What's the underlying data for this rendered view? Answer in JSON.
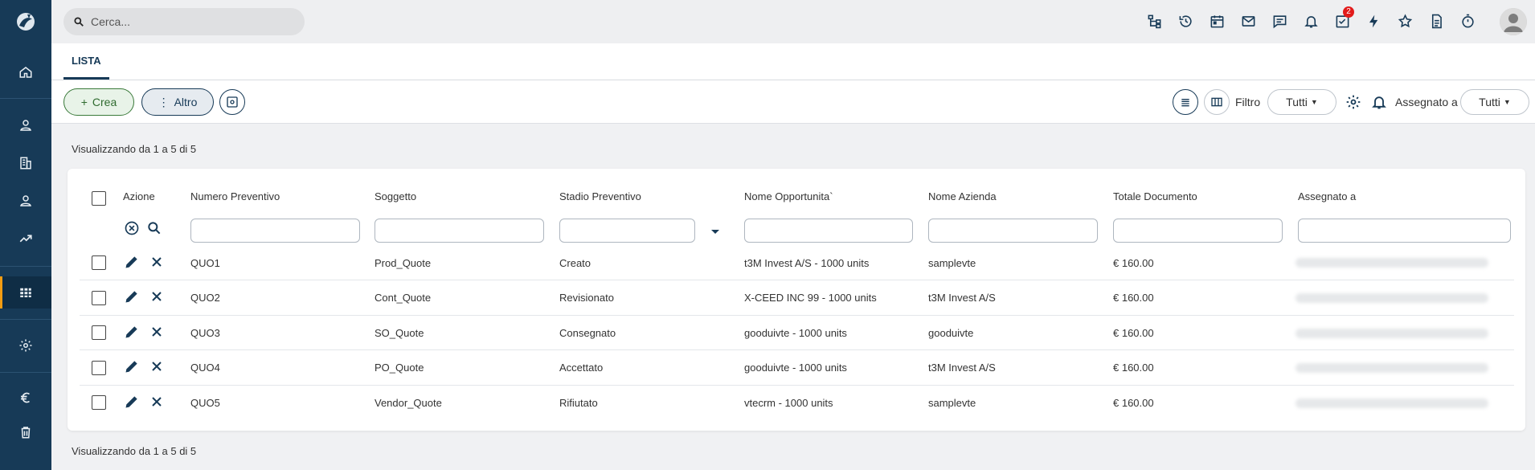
{
  "sidebar": {
    "items": [
      {
        "name": "home",
        "icon": "home-icon"
      },
      {
        "name": "contacts",
        "icon": "person-icon"
      },
      {
        "name": "companies",
        "icon": "building-icon"
      },
      {
        "name": "leads",
        "icon": "person-icon"
      },
      {
        "name": "sales",
        "icon": "trend-icon"
      },
      {
        "name": "grid",
        "icon": "grid-icon",
        "active": true
      },
      {
        "name": "settings",
        "icon": "gear-icon"
      },
      {
        "name": "finance",
        "icon": "euro-icon"
      },
      {
        "name": "trash",
        "icon": "trash-icon"
      }
    ]
  },
  "topbar": {
    "search_placeholder": "Cerca...",
    "icons": [
      "hierarchy-icon",
      "history-icon",
      "calendar-icon",
      "mail-icon",
      "chat-icon",
      "bell-icon",
      "tasks-icon",
      "bolt-icon",
      "star-icon",
      "document-icon",
      "timer-icon"
    ],
    "tasks_badge": "2"
  },
  "tabs": [
    {
      "label": "LISTA"
    }
  ],
  "toolbar": {
    "create_label": "Crea",
    "more_label": "Altro",
    "filter_label": "Filtro",
    "filter_value": "Tutti",
    "assigned_label": "Assegnato a",
    "assigned_value": "Tutti"
  },
  "showing_text": "Visualizzando da 1 a 5 di 5",
  "table": {
    "columns": [
      "Azione",
      "Numero Preventivo",
      "Soggetto",
      "Stadio Preventivo",
      "Nome Opportunita`",
      "Nome Azienda",
      "Totale Documento",
      "Assegnato a"
    ],
    "rows": [
      {
        "numero": "QUO1",
        "soggetto": "Prod_Quote",
        "stadio": "Creato",
        "opportunita": "t3M Invest A/S - 1000 units",
        "azienda": "samplevte",
        "totale": "€ 160.00"
      },
      {
        "numero": "QUO2",
        "soggetto": "Cont_Quote",
        "stadio": "Revisionato",
        "opportunita": "X-CEED INC 99 - 1000 units",
        "azienda": "t3M Invest A/S",
        "totale": "€ 160.00"
      },
      {
        "numero": "QUO3",
        "soggetto": "SO_Quote",
        "stadio": "Consegnato",
        "opportunita": "gooduivte - 1000 units",
        "azienda": "gooduivte",
        "totale": "€ 160.00"
      },
      {
        "numero": "QUO4",
        "soggetto": "PO_Quote",
        "stadio": "Accettato",
        "opportunita": "gooduivte - 1000 units",
        "azienda": "t3M Invest A/S",
        "totale": "€ 160.00"
      },
      {
        "numero": "QUO5",
        "soggetto": "Vendor_Quote",
        "stadio": "Rifiutato",
        "opportunita": "vtecrm - 1000 units",
        "azienda": "samplevte",
        "totale": "€ 160.00"
      }
    ]
  },
  "colors": {
    "sidebar": "#173a57",
    "accent": "#f39c12",
    "create": "#2f6b2f",
    "badge": "#e21b1b"
  }
}
